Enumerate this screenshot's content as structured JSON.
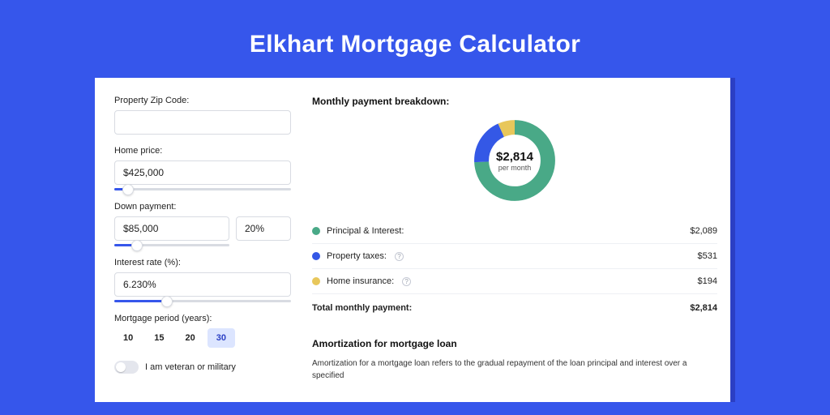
{
  "title": "Elkhart Mortgage Calculator",
  "form": {
    "zip": {
      "label": "Property Zip Code:",
      "value": ""
    },
    "home_price": {
      "label": "Home price:",
      "value": "$425,000",
      "slider_pct": 8
    },
    "down_payment": {
      "label": "Down payment:",
      "amount": "$85,000",
      "pct": "20%",
      "slider_pct": 20
    },
    "interest": {
      "label": "Interest rate (%):",
      "value": "6.230%",
      "slider_pct": 30
    },
    "period": {
      "label": "Mortgage period (years):",
      "options": [
        "10",
        "15",
        "20",
        "30"
      ],
      "selected": "30"
    },
    "veteran": {
      "label": "I am veteran or military",
      "on": false
    }
  },
  "breakdown": {
    "title": "Monthly payment breakdown:",
    "center_amount": "$2,814",
    "center_sub": "per month",
    "items": [
      {
        "label": "Principal & Interest:",
        "value": "$2,089",
        "color": "#49a987",
        "info": false
      },
      {
        "label": "Property taxes:",
        "value": "$531",
        "color": "#3458e6",
        "info": true
      },
      {
        "label": "Home insurance:",
        "value": "$194",
        "color": "#e8c75b",
        "info": true
      }
    ],
    "total_label": "Total monthly payment:",
    "total_value": "$2,814"
  },
  "chart_data": {
    "type": "pie",
    "title": "Monthly payment breakdown",
    "series": [
      {
        "name": "Principal & Interest",
        "value": 2089,
        "color": "#49a987"
      },
      {
        "name": "Property taxes",
        "value": 531,
        "color": "#3458e6"
      },
      {
        "name": "Home insurance",
        "value": 194,
        "color": "#e8c75b"
      }
    ],
    "total": 2814,
    "center_label": "$2,814 per month"
  },
  "amort": {
    "title": "Amortization for mortgage loan",
    "text": "Amortization for a mortgage loan refers to the gradual repayment of the loan principal and interest over a specified"
  }
}
